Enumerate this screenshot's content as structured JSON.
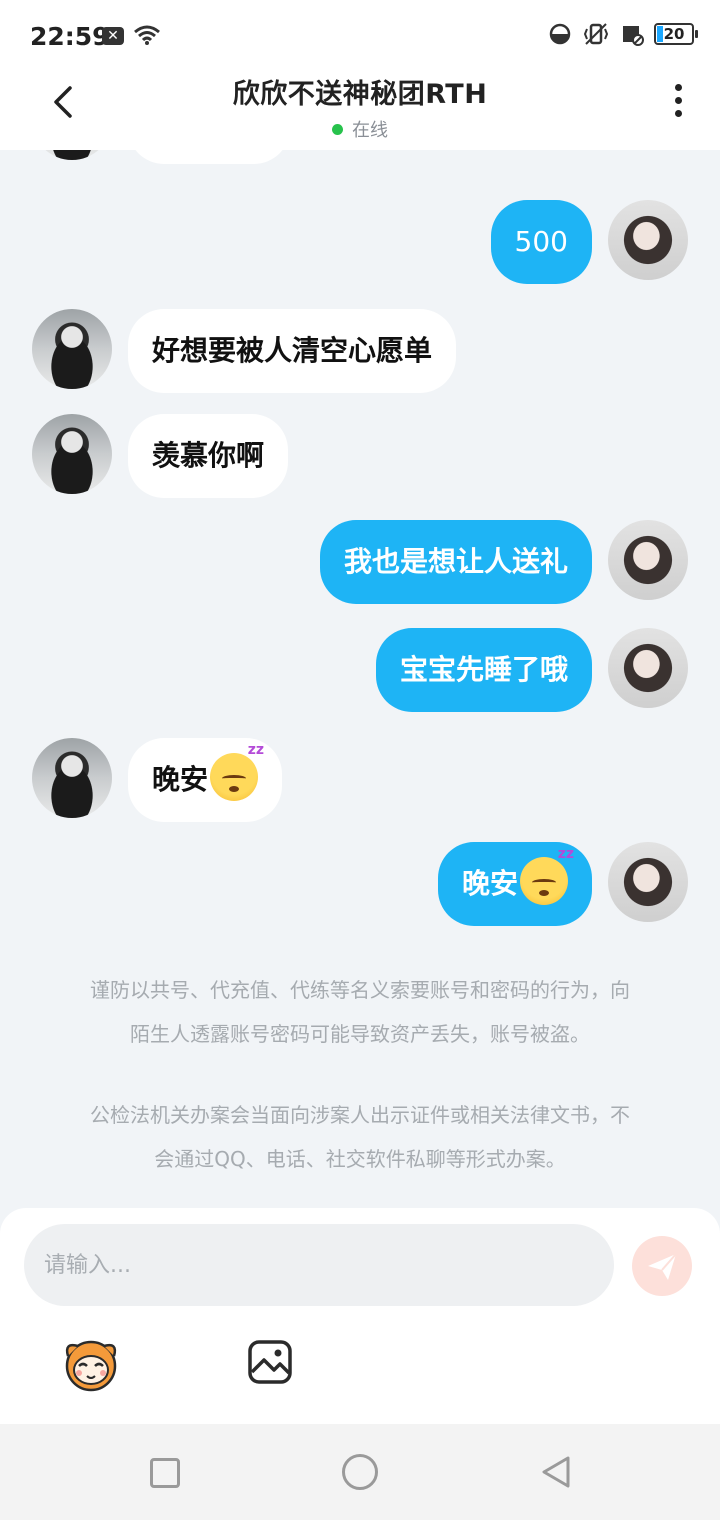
{
  "status_bar": {
    "time": "22:59",
    "battery": "20",
    "icons": [
      "close-notification-icon",
      "wifi-icon",
      "data-saver-icon",
      "vibrate-icon",
      "sim-off-icon",
      "battery-icon"
    ]
  },
  "header": {
    "title": "欣欣不送神秘团RTH",
    "presence": "在线",
    "presence_color": "#27c24c"
  },
  "messages": [
    {
      "from": "me",
      "text": "500"
    },
    {
      "from": "them",
      "text": "好想要被人清空心愿单"
    },
    {
      "from": "them",
      "text": "羡慕你啊"
    },
    {
      "from": "me",
      "text": "我也是想让人送礼"
    },
    {
      "from": "me",
      "text": "宝宝先睡了哦"
    },
    {
      "from": "them",
      "text": "晚安",
      "emoji": "sleeping-face"
    },
    {
      "from": "me",
      "text": "晚安",
      "emoji": "sleeping-face"
    }
  ],
  "emoji_zz": "zz",
  "notices": {
    "line1": "谨防以共号、代充值、代练等名义索要账号和密码的行为，向",
    "line2": "陌生人透露账号密码可能导致资产丢失，账号被盗。",
    "line3": "公检法机关办案会当面向涉案人出示证件或相关法律文书，不",
    "line4": "会通过QQ、电话、社交软件私聊等形式办案。"
  },
  "input": {
    "placeholder": "请输入...",
    "value": ""
  },
  "colors": {
    "my_bubble": "#1eb4f5",
    "their_bubble": "#ffffff",
    "background": "#f1f4f7",
    "send_button": "#fde0da"
  }
}
